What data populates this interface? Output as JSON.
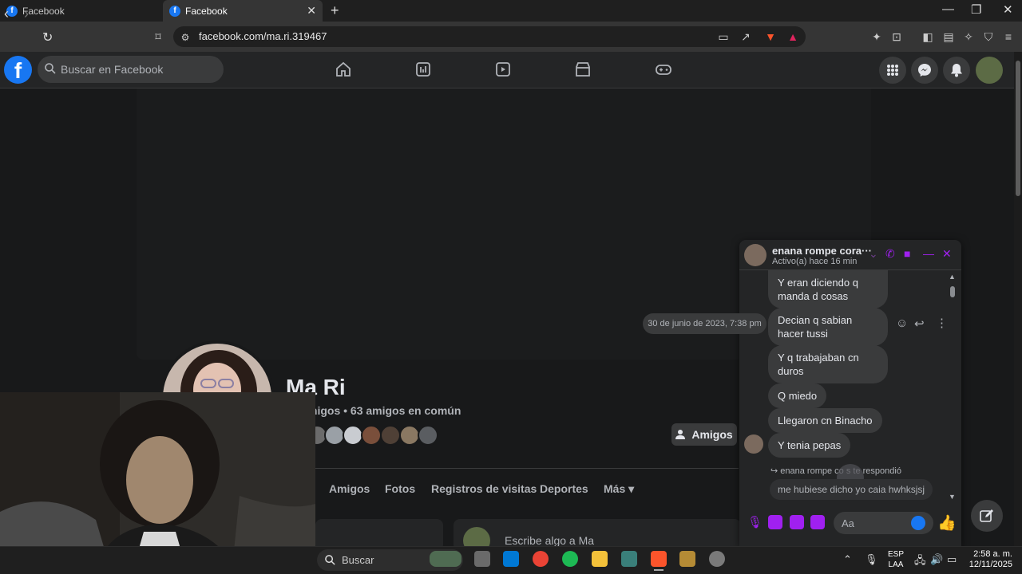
{
  "browser": {
    "tabs": [
      {
        "label": "Facebook",
        "favicon": "f"
      },
      {
        "label": "Facebook",
        "favicon": "f"
      }
    ],
    "new_tab": "+",
    "url": "facebook.com/ma.ri.319467",
    "window_controls": {
      "minimize": "—",
      "maximize": "❐",
      "close": "✕"
    }
  },
  "fb": {
    "logo": "f",
    "search_placeholder": "Buscar en Facebook",
    "nav_icons": [
      "home-icon",
      "dashboard-icon",
      "video-icon",
      "marketplace-icon",
      "gaming-icon"
    ]
  },
  "profile": {
    "name": "Ma Ri",
    "friends_line": "migos • 63 amigos en común",
    "friends_button": "Amigos",
    "tabs": [
      "Amigos",
      "Fotos",
      "Registros de visitas",
      "Deportes",
      "Más ▾"
    ],
    "post_placeholder": "Escribe algo a Ma"
  },
  "chat": {
    "name": "enana rompe cora···",
    "status": "Activo(a) hace 16 min",
    "date_stamp": "30 de junio de 2023, 7:38 pm",
    "messages": [
      "Y eran diciendo q manda d cosas",
      "Decian q sabian hacer tussi",
      "Y q trabajaban cn duros",
      "Q miedo",
      "Llegaron cn Binacho",
      "Y tenia pepas"
    ],
    "reply_note": "enana rompe co    s te respondió",
    "reply_text": "me hubiese dicho yo caia hwhksjsj",
    "input_placeholder": "Aa"
  },
  "taskbar": {
    "search_label": "Buscar",
    "lang_line1": "ESP",
    "lang_line2": "LAA",
    "time": "2:58 a. m.",
    "date": "12/11/2025"
  },
  "colors": {
    "accent": "#1877f2",
    "messenger_purple": "#a020f0"
  }
}
